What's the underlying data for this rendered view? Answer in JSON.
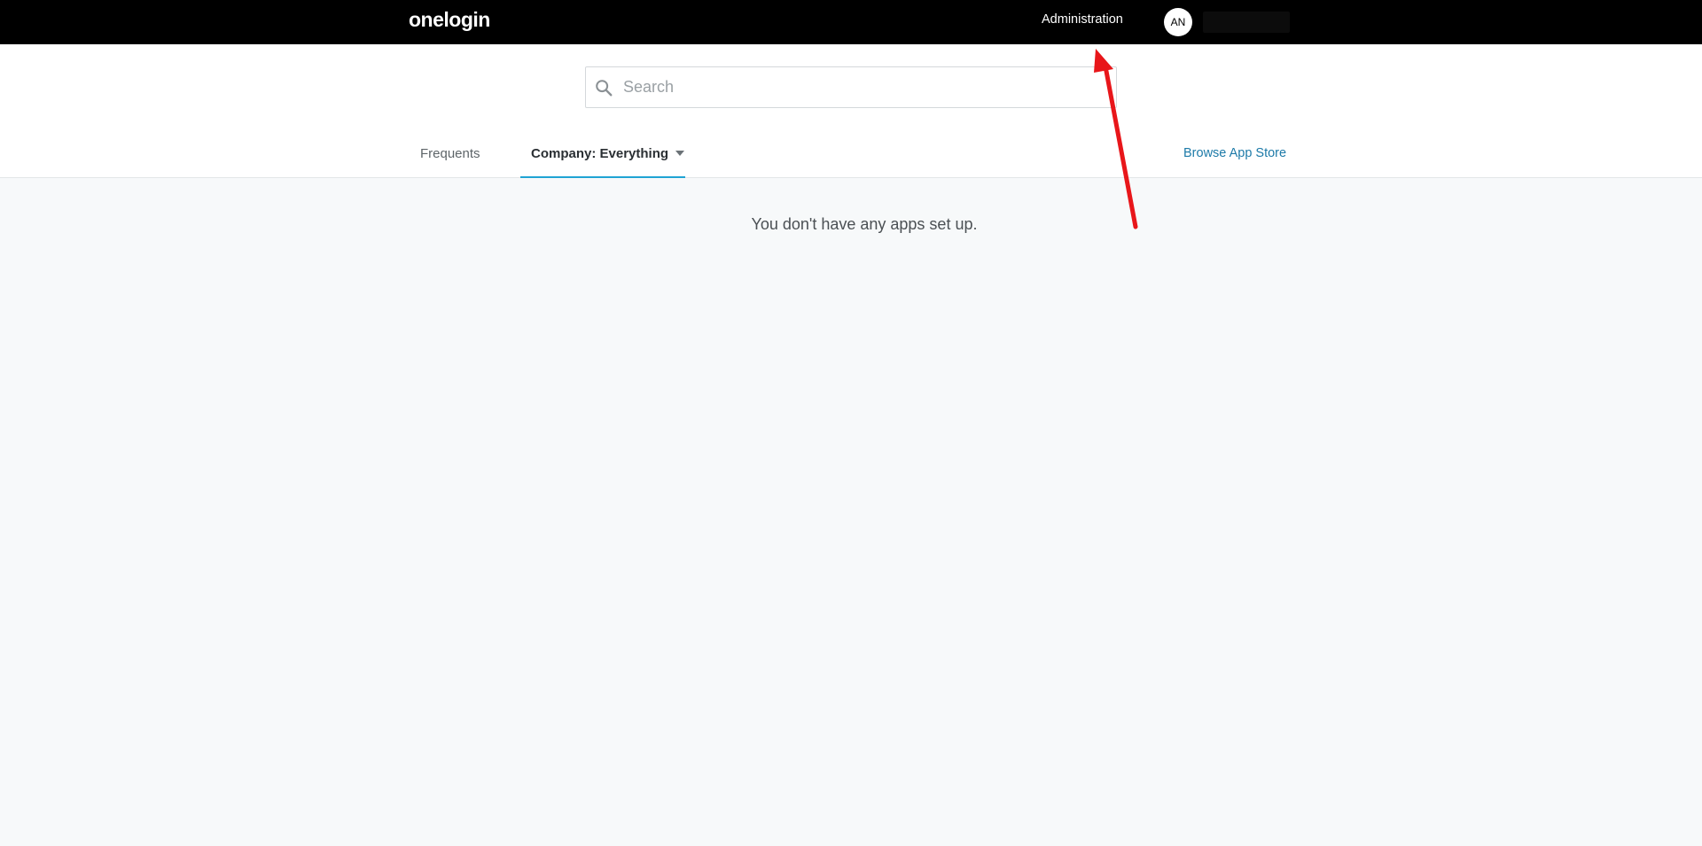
{
  "topbar": {
    "logo_text": "onelogin",
    "admin_label": "Administration",
    "avatar_initials": "AN"
  },
  "search": {
    "placeholder": "Search",
    "value": ""
  },
  "tabs": [
    {
      "label": "Frequents",
      "active": false
    },
    {
      "label": "Company: Everything",
      "active": true
    }
  ],
  "browse_label": "Browse App Store",
  "empty_message": "You don't have any apps set up.",
  "colors": {
    "topbar": "#000000",
    "active_tab_underline": "#1fa4d4",
    "link": "#1d7aa8",
    "annotation": "#e8161a"
  }
}
